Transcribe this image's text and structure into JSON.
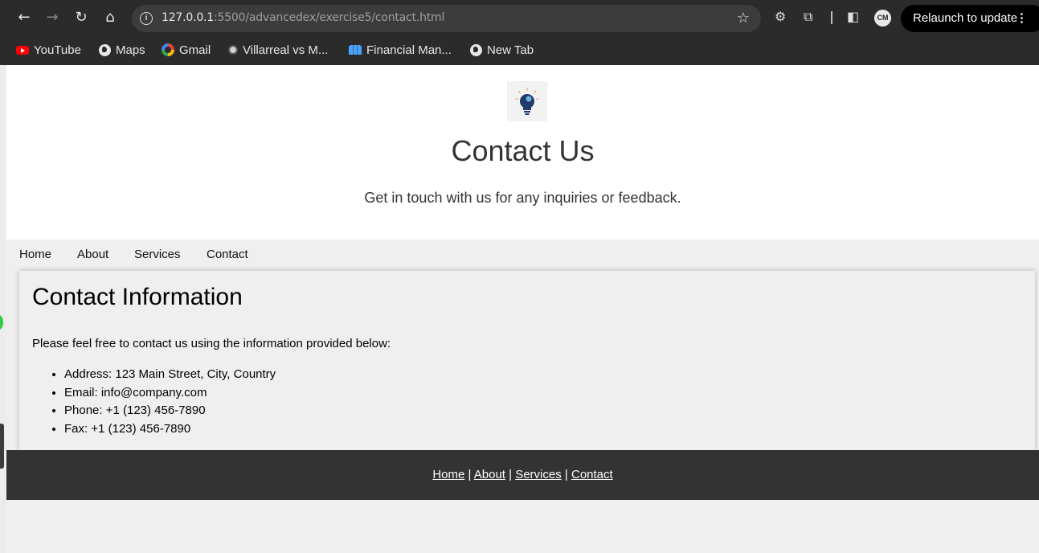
{
  "browser": {
    "url_host": "127.0.0.1",
    "url_rest": ":5500/advancedex/exercise5/contact.html",
    "relaunch_label": "Relaunch to update",
    "avatar_initials": "CM",
    "bookmarks": [
      {
        "label": "YouTube",
        "icon": "youtube-icon"
      },
      {
        "label": "Maps",
        "icon": "globe-icon"
      },
      {
        "label": "Gmail",
        "icon": "google-icon"
      },
      {
        "label": "Villarreal vs M...",
        "icon": "soccer-ball-icon"
      },
      {
        "label": "Financial Man...",
        "icon": "people-icon"
      },
      {
        "label": "New Tab",
        "icon": "globe-icon"
      }
    ]
  },
  "header": {
    "title": "Contact Us",
    "subtitle": "Get in touch with us for any inquiries or feedback."
  },
  "nav": {
    "items": [
      "Home",
      "About",
      "Services",
      "Contact"
    ]
  },
  "contact": {
    "heading": "Contact Information",
    "intro": "Please feel free to contact us using the information provided below:",
    "items": [
      "Address: 123 Main Street, City, Country",
      "Email: info@company.com",
      "Phone: +1 (123) 456-7890",
      "Fax: +1 (123) 456-7890"
    ]
  },
  "footer": {
    "links": [
      "Home",
      "About",
      "Services",
      "Contact"
    ],
    "separator": "|"
  }
}
